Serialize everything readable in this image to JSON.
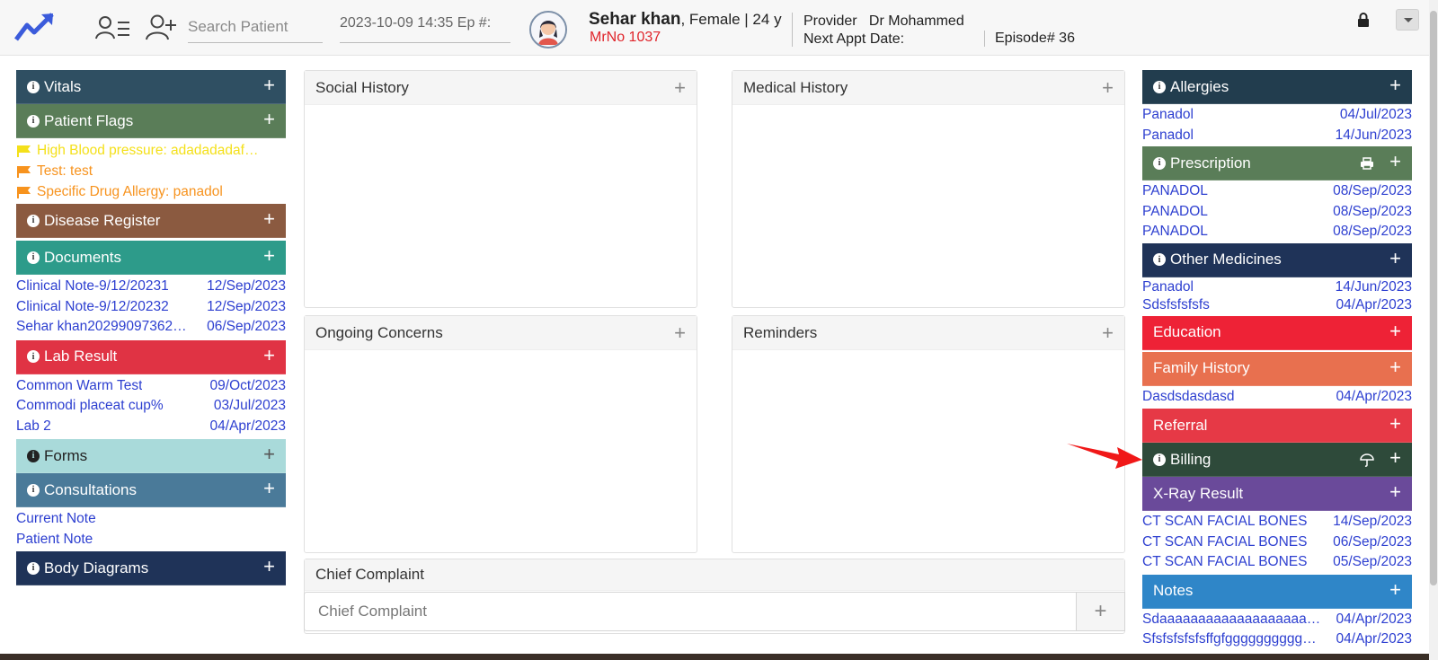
{
  "header": {
    "search_placeholder": "Search Patient",
    "datetime": "2023-10-09 14:35 Ep #:",
    "patient_name": "Sehar khan",
    "patient_details": ", Female | 24 y",
    "mrno": "MrNo 1037",
    "provider_label": "Provider",
    "provider_name": "Dr Mohammed",
    "next_appt_label": "Next Appt Date:",
    "episode": "Episode# 36"
  },
  "left": {
    "vitals": "Vitals",
    "patient_flags": "Patient Flags",
    "flags": [
      {
        "text": "High Blood pressure: adadadadaf…",
        "color": "#f4e01a"
      },
      {
        "text": "Test: test",
        "color": "#f7931e"
      },
      {
        "text": "Specific Drug Allergy: panadol",
        "color": "#f7931e"
      }
    ],
    "disease_register": "Disease Register",
    "documents": "Documents",
    "document_rows": [
      {
        "name": "Clinical Note-9/12/20231",
        "date": "12/Sep/2023"
      },
      {
        "name": "Clinical Note-9/12/20232",
        "date": "12/Sep/2023"
      },
      {
        "name": "Sehar khan20299097362…",
        "date": "06/Sep/2023"
      }
    ],
    "lab_result": "Lab Result",
    "lab_rows": [
      {
        "name": "Common Warm Test",
        "date": "09/Oct/2023"
      },
      {
        "name": "Commodi placeat cup%",
        "date": "03/Jul/2023"
      },
      {
        "name": "Lab 2",
        "date": "04/Apr/2023"
      }
    ],
    "forms": "Forms",
    "consultations": "Consultations",
    "consultation_links": [
      "Current Note",
      "Patient Note"
    ],
    "body_diagrams": "Body Diagrams"
  },
  "center": {
    "social_history": "Social History",
    "medical_history": "Medical History",
    "ongoing_concerns": "Ongoing Concerns",
    "reminders": "Reminders",
    "chief_complaint": "Chief Complaint",
    "chief_complaint_placeholder": "Chief Complaint",
    "chief_complaint_add": "+"
  },
  "right": {
    "allergies": "Allergies",
    "allergy_rows": [
      {
        "name": "Panadol",
        "date": "04/Jul/2023"
      },
      {
        "name": "Panadol",
        "date": "14/Jun/2023"
      }
    ],
    "prescription": "Prescription",
    "prescription_rows": [
      {
        "name": "PANADOL",
        "date": "08/Sep/2023"
      },
      {
        "name": "PANADOL",
        "date": "08/Sep/2023"
      },
      {
        "name": "PANADOL",
        "date": "08/Sep/2023"
      }
    ],
    "other_medicines": "Other Medicines",
    "other_medicine_rows": [
      {
        "name": "Panadol",
        "date": "14/Jun/2023"
      },
      {
        "name": "Sdsfsfsfsfs",
        "date": "04/Apr/2023"
      }
    ],
    "education": "Education",
    "family_history": "Family History",
    "family_history_rows": [
      {
        "name": "Dasdsdasdasd",
        "date": "04/Apr/2023"
      }
    ],
    "referral": "Referral",
    "billing": "Billing",
    "xray_result": "X-Ray Result",
    "xray_rows": [
      {
        "name": "CT SCAN FACIAL BONES",
        "date": "14/Sep/2023"
      },
      {
        "name": "CT SCAN FACIAL BONES",
        "date": "06/Sep/2023"
      },
      {
        "name": "CT SCAN FACIAL BONES",
        "date": "05/Sep/2023"
      }
    ],
    "notes": "Notes",
    "note_rows": [
      {
        "name": "Sdaaaaaaaaaaaaaaaaaaa…",
        "date": "04/Apr/2023"
      },
      {
        "name": "Sfsfsfsfsfsffgfgggggggggg…",
        "date": "04/Apr/2023"
      }
    ]
  },
  "colors": {
    "vitals": "#2f4f62",
    "patient_flags": "#5a7d58",
    "disease_register": "#8b5a40",
    "documents": "#2d9b8a",
    "lab_result": "#e03344",
    "forms": "#a9dada",
    "consultations": "#4a7a99",
    "body_diagrams": "#1f3358",
    "allergies": "#223d4e",
    "prescription": "#5a7d58",
    "other_medicines": "#1f3358",
    "education": "#ee2236",
    "family_history": "#e8704f",
    "referral": "#e63946",
    "billing": "#2e4a3a",
    "xray_result": "#6a4a9a",
    "notes": "#2f86c8",
    "link": "#2d3fd0",
    "mrno": "#e0252b"
  }
}
